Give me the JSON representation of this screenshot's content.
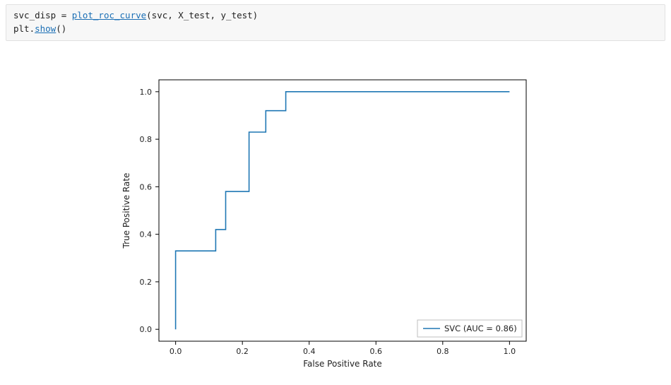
{
  "code": {
    "line1_pre": "svc_disp = ",
    "line1_fn": "plot_roc_curve",
    "line1_post": "(svc, X_test, y_test)",
    "line2_obj": "plt",
    "line2_fn": "show",
    "line2_post": "()"
  },
  "chart_data": {
    "type": "line",
    "title": "",
    "xlabel": "False Positive Rate",
    "ylabel": "True Positive Rate",
    "xlim": [
      -0.05,
      1.05
    ],
    "ylim": [
      -0.05,
      1.05
    ],
    "xticks": [
      0.0,
      0.2,
      0.4,
      0.6,
      0.8,
      1.0
    ],
    "yticks": [
      0.0,
      0.2,
      0.4,
      0.6,
      0.8,
      1.0
    ],
    "series": [
      {
        "name": "SVC (AUC = 0.86)",
        "color": "#1f77b4",
        "points": [
          [
            0.0,
            0.0
          ],
          [
            0.0,
            0.33
          ],
          [
            0.12,
            0.33
          ],
          [
            0.12,
            0.42
          ],
          [
            0.15,
            0.42
          ],
          [
            0.15,
            0.58
          ],
          [
            0.22,
            0.58
          ],
          [
            0.22,
            0.83
          ],
          [
            0.27,
            0.83
          ],
          [
            0.27,
            0.92
          ],
          [
            0.33,
            0.92
          ],
          [
            0.33,
            1.0
          ],
          [
            1.0,
            1.0
          ]
        ]
      }
    ],
    "legend": {
      "position": "lower right"
    }
  }
}
